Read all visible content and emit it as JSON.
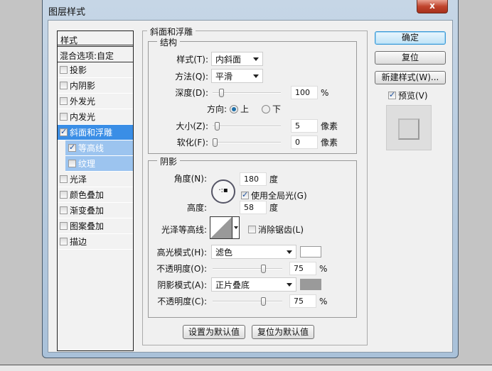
{
  "window": {
    "title": "图层样式",
    "close_label": "x"
  },
  "styles_list": {
    "header": "样式",
    "blending": "混合选项:自定",
    "items": [
      {
        "label": "投影",
        "checked": false
      },
      {
        "label": "内阴影",
        "checked": false
      },
      {
        "label": "外发光",
        "checked": false
      },
      {
        "label": "内发光",
        "checked": false
      },
      {
        "label": "斜面和浮雕",
        "checked": true,
        "selected": true
      },
      {
        "label": "等高线",
        "checked": true,
        "sub": true
      },
      {
        "label": "纹理",
        "checked": false,
        "sub": true
      },
      {
        "label": "光泽",
        "checked": false
      },
      {
        "label": "颜色叠加",
        "checked": false
      },
      {
        "label": "渐变叠加",
        "checked": false
      },
      {
        "label": "图案叠加",
        "checked": false
      },
      {
        "label": "描边",
        "checked": false
      }
    ]
  },
  "bevel": {
    "title": "斜面和浮雕",
    "structure": {
      "title": "结构",
      "style_label": "样式(T):",
      "style_value": "内斜面",
      "technique_label": "方法(Q):",
      "technique_value": "平滑",
      "depth_label": "深度(D):",
      "depth_value": "100",
      "depth_unit": "%",
      "depth_slider": 0.1,
      "direction_label": "方向:",
      "dir_up": "上",
      "dir_down": "下",
      "direction_selected": "上",
      "size_label": "大小(Z):",
      "size_value": "5",
      "size_unit": "像素",
      "size_slider": 0.03,
      "soften_label": "软化(F):",
      "soften_value": "0",
      "soften_unit": "像素",
      "soften_slider": 0
    },
    "shading": {
      "title": "阴影",
      "angle_label": "角度(N):",
      "angle_value": "180",
      "angle_unit": "度",
      "global_light_label": "使用全局光(G)",
      "global_light": true,
      "altitude_label": "高度:",
      "altitude_value": "58",
      "altitude_unit": "度",
      "gloss_label": "光泽等高线:",
      "antialias_label": "消除锯齿(L)",
      "antialias": false,
      "highlight_label": "高光模式(H):",
      "highlight_mode": "滤色",
      "highlight_color": "#ffffff",
      "hl_opacity_label": "不透明度(O):",
      "hl_opacity": "75",
      "hl_unit": "%",
      "hl_slider": 0.75,
      "shadow_label": "阴影模式(A):",
      "shadow_mode": "正片叠底",
      "shadow_color": "#9a9a9a",
      "sh_opacity_label": "不透明度(C):",
      "sh_opacity": "75",
      "sh_unit": "%",
      "sh_slider": 0.75
    },
    "make_default": "设置为默认值",
    "reset_default": "复位为默认值"
  },
  "side": {
    "ok": "确定",
    "reset": "复位",
    "new_style": "新建样式(W)...",
    "preview_label": "预览(V)",
    "preview": true
  }
}
